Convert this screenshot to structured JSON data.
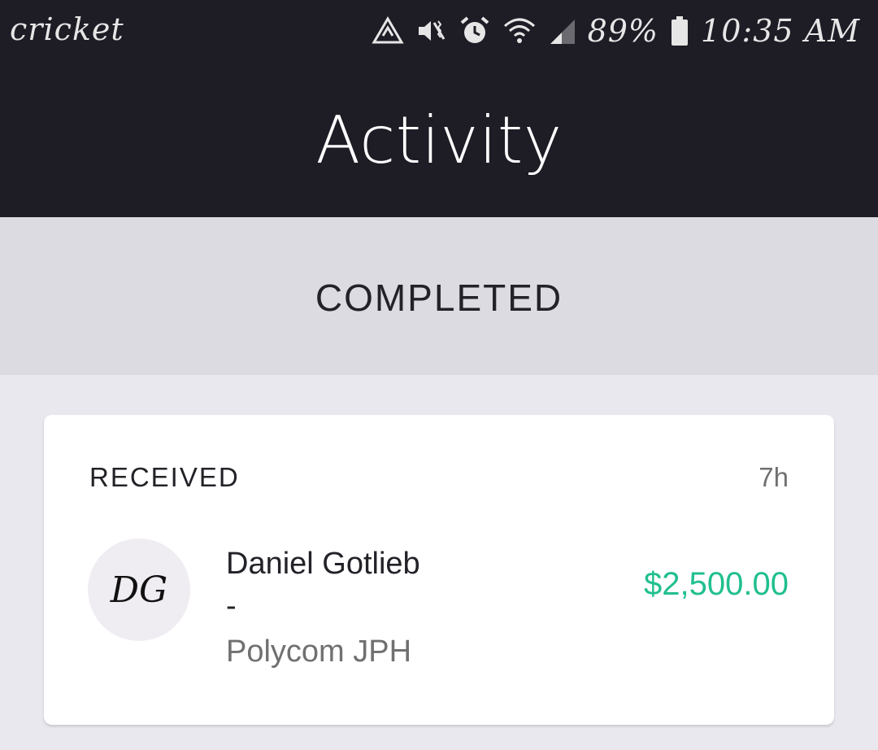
{
  "status_bar": {
    "carrier": "cricket",
    "icons": [
      "recycle-triangle-icon",
      "vibrate-mute-icon",
      "alarm-icon",
      "wifi-icon",
      "signal-icon",
      "battery-icon"
    ],
    "battery_percent": "89%",
    "time": "10:35 AM"
  },
  "header": {
    "title": "Activity"
  },
  "section": {
    "title": "COMPLETED"
  },
  "transaction": {
    "type_label": "RECEIVED",
    "time_ago": "7h",
    "avatar_initials": "DG",
    "name": "Daniel Gotlieb",
    "separator": "-",
    "memo": "Polycom JPH",
    "amount": "$2,500.00",
    "amount_color": "#21bf8f"
  }
}
